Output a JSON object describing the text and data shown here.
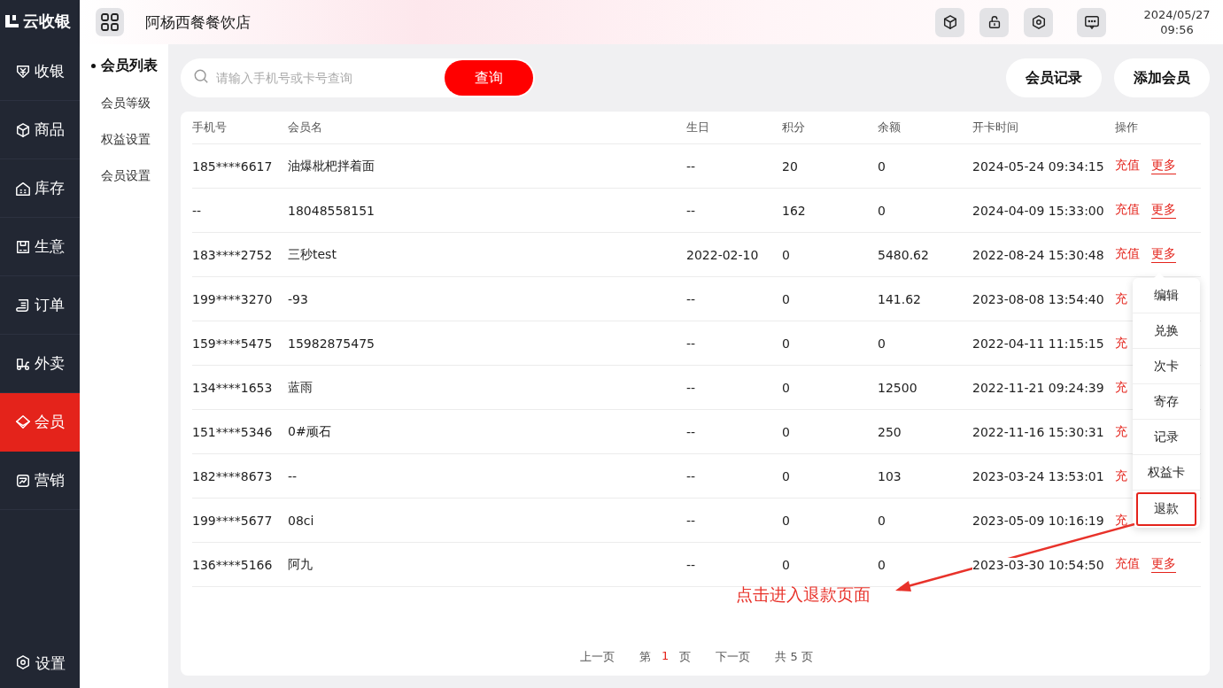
{
  "logo": {
    "text": "云收银"
  },
  "nav": [
    {
      "label": "收银",
      "selected": false
    },
    {
      "label": "商品",
      "selected": false
    },
    {
      "label": "库存",
      "selected": false
    },
    {
      "label": "生意",
      "selected": false
    },
    {
      "label": "订单",
      "selected": false
    },
    {
      "label": "外卖",
      "selected": false
    },
    {
      "label": "会员",
      "selected": true
    },
    {
      "label": "营销",
      "selected": false
    }
  ],
  "settings": {
    "label": "设置"
  },
  "header": {
    "store": "阿杨西餐餐饮店",
    "date": "2024/05/27",
    "time": "09:56"
  },
  "subnav": [
    {
      "label": "会员列表",
      "selected": true
    },
    {
      "label": "会员等级",
      "selected": false
    },
    {
      "label": "权益设置",
      "selected": false
    },
    {
      "label": "会员设置",
      "selected": false
    }
  ],
  "search": {
    "placeholder": "请输入手机号或卡号查询",
    "button": "查询"
  },
  "top_buttons": [
    "会员记录",
    "添加会员"
  ],
  "table": {
    "columns": [
      "手机号",
      "会员名",
      "生日",
      "积分",
      "余额",
      "开卡时间",
      "操作"
    ],
    "rows": [
      {
        "cells": [
          "185****6617",
          "油爆枇杷拌着面",
          "--",
          "20",
          "0",
          "2024-05-24 09:34:15"
        ],
        "actions": [
          {
            "kind": "recharge",
            "label": "充值"
          },
          {
            "kind": "more",
            "label": "更多"
          }
        ]
      },
      {
        "cells": [
          "--",
          "18048558151",
          "--",
          "162",
          "0",
          "2024-04-09 15:33:00"
        ],
        "actions": [
          {
            "kind": "recharge",
            "label": "充值"
          },
          {
            "kind": "more",
            "label": "更多"
          }
        ]
      },
      {
        "cells": [
          "183****2752",
          "三秒test",
          "2022-02-10",
          "0",
          "5480.62",
          "2022-08-24 15:30:48"
        ],
        "actions": [
          {
            "kind": "recharge",
            "label": "充值"
          },
          {
            "kind": "more",
            "label": "更多"
          }
        ]
      },
      {
        "cells": [
          "199****3270",
          "-93",
          "--",
          "0",
          "141.62",
          "2023-08-08 13:54:40"
        ],
        "actions": [
          {
            "kind": "recharge",
            "label": "充"
          }
        ]
      },
      {
        "cells": [
          "159****5475",
          "15982875475",
          "--",
          "0",
          "0",
          "2022-04-11 11:15:15"
        ],
        "actions": [
          {
            "kind": "recharge",
            "label": "充"
          }
        ]
      },
      {
        "cells": [
          "134****1653",
          "蓝雨",
          "--",
          "0",
          "12500",
          "2022-11-21 09:24:39"
        ],
        "actions": [
          {
            "kind": "recharge",
            "label": "充"
          }
        ]
      },
      {
        "cells": [
          "151****5346",
          "0#顽石",
          "--",
          "0",
          "250",
          "2022-11-16 15:30:31"
        ],
        "actions": [
          {
            "kind": "recharge",
            "label": "充"
          }
        ]
      },
      {
        "cells": [
          "182****8673",
          "--",
          "--",
          "0",
          "103",
          "2023-03-24 13:53:01"
        ],
        "actions": [
          {
            "kind": "recharge",
            "label": "充"
          }
        ]
      },
      {
        "cells": [
          "199****5677",
          "08ci",
          "--",
          "0",
          "0",
          "2023-05-09 10:16:19"
        ],
        "actions": [
          {
            "kind": "recharge",
            "label": "充"
          }
        ]
      },
      {
        "cells": [
          "136****5166",
          "阿九",
          "--",
          "0",
          "0",
          "2023-03-30 10:54:50"
        ],
        "actions": [
          {
            "kind": "recharge",
            "label": "充值"
          },
          {
            "kind": "more",
            "label": "更多"
          }
        ]
      }
    ]
  },
  "more_menu": {
    "items": [
      {
        "label": "编辑",
        "highlighted": false
      },
      {
        "label": "兑换",
        "highlighted": false
      },
      {
        "label": "次卡",
        "highlighted": false
      },
      {
        "label": "寄存",
        "highlighted": false
      },
      {
        "label": "记录",
        "highlighted": false
      },
      {
        "label": "权益卡",
        "highlighted": false
      },
      {
        "label": "退款",
        "highlighted": true
      }
    ]
  },
  "annotation": {
    "text": "点击进入退款页面"
  },
  "pagination": {
    "prev": "上一页",
    "page_prefix": "第",
    "page": "1",
    "page_suffix": "页",
    "next": "下一页",
    "total": "共 5 页"
  }
}
